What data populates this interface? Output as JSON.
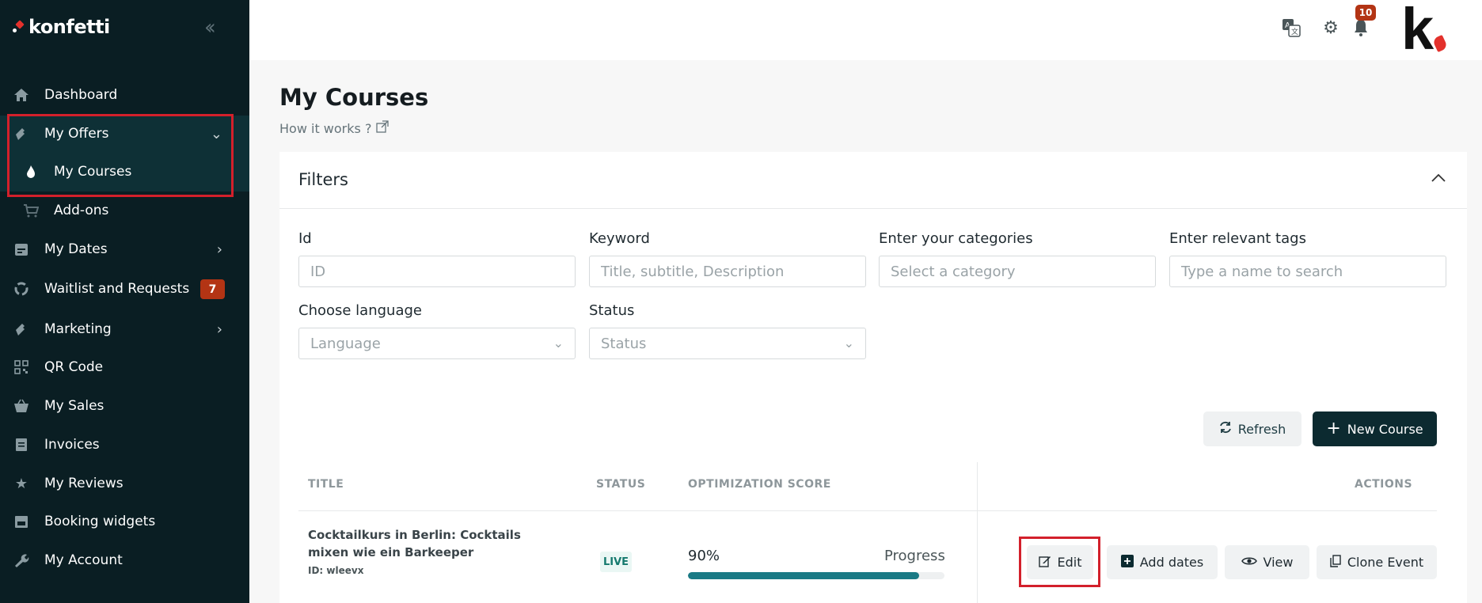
{
  "brand": {
    "name": "konfetti"
  },
  "sidebar": {
    "items": [
      {
        "label": "Dashboard",
        "icon": "home-icon"
      },
      {
        "label": "My Offers",
        "icon": "ticket-icon"
      },
      {
        "label": "My Courses",
        "icon": "flame-icon"
      },
      {
        "label": "Add-ons",
        "icon": "cart-icon"
      },
      {
        "label": "My Dates",
        "icon": "calendar-icon"
      },
      {
        "label": "Waitlist and Requests",
        "icon": "refresh-users-icon",
        "badge": "7"
      },
      {
        "label": "Marketing",
        "icon": "megaphone-icon"
      },
      {
        "label": "QR Code",
        "icon": "qr-code-icon"
      },
      {
        "label": "My Sales",
        "icon": "basket-icon"
      },
      {
        "label": "Invoices",
        "icon": "invoice-icon"
      },
      {
        "label": "My Reviews",
        "icon": "star-icon"
      },
      {
        "label": "Booking widgets",
        "icon": "widget-icon"
      },
      {
        "label": "My Account",
        "icon": "wrench-icon"
      }
    ]
  },
  "topbar": {
    "notification_count": "10",
    "brand_mark": "k"
  },
  "main": {
    "title": "My Courses",
    "how_it_works": "How it works ?",
    "filters": {
      "title": "Filters",
      "id_label": "Id",
      "id_placeholder": "ID",
      "keyword_label": "Keyword",
      "keyword_placeholder": "Title, subtitle, Description",
      "categories_label": "Enter your categories",
      "categories_placeholder": "Select a category",
      "tags_label": "Enter relevant tags",
      "tags_placeholder": "Type a name to search",
      "language_label": "Choose language",
      "language_value": "Language",
      "status_label": "Status",
      "status_value": "Status"
    },
    "buttons": {
      "refresh": "Refresh",
      "new_course": "New Course"
    },
    "table": {
      "headers": {
        "title": "TITLE",
        "status": "STATUS",
        "score": "OPTIMIZATION SCORE",
        "actions": "ACTIONS"
      },
      "rows": [
        {
          "title": "Cocktailkurs in Berlin: Cocktails mixen wie ein Barkeeper",
          "id": "ID: wleevx",
          "status": "LIVE",
          "score": "90%",
          "score_value": 0.9,
          "progress_label": "Progress",
          "actions": {
            "edit": "Edit",
            "add_dates": "Add dates",
            "view": "View",
            "clone": "Clone Event"
          }
        }
      ]
    }
  },
  "colors": {
    "sidebar_bg": "#0a1e23",
    "accent": "#1a7a85",
    "badge": "#b33414",
    "highlight": "#d3202b"
  }
}
